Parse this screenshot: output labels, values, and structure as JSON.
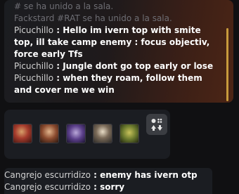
{
  "chat_top": {
    "faded_lines": [
      "# se ha unido a la sala.",
      "Fackstard #RAT se ha unido a la sala."
    ],
    "messages": [
      {
        "author": "Picuchillo",
        "sep": " : ",
        "text": "Hello im ivern top with smite top, ill take camp enemy : focus objectiv, force early Tfs"
      },
      {
        "author": "Picuchillo",
        "sep": " : ",
        "text": "Jungle dont go top early or lose"
      },
      {
        "author": "Picuchillo",
        "sep": " : ",
        "text": "when they roam, follow them and cover me we win"
      }
    ]
  },
  "team": {
    "portraits": [
      {
        "icon": "champion-portrait-1"
      },
      {
        "icon": "champion-portrait-2"
      },
      {
        "icon": "champion-portrait-3"
      },
      {
        "icon": "champion-portrait-4"
      },
      {
        "icon": "champion-portrait-5"
      }
    ],
    "swap_icon": "swap-positions-icon"
  },
  "chat_bottom": {
    "messages": [
      {
        "author": "Cangrejo escurridizo",
        "sep": " : ",
        "text": "enemy has ivern otp"
      },
      {
        "author": "Cangrejo escurridizo",
        "sep": " : ",
        "text": "sorry"
      }
    ]
  },
  "colors": {
    "accent_gold": "#c89b3c",
    "panel_bg": "#1b1d22"
  }
}
